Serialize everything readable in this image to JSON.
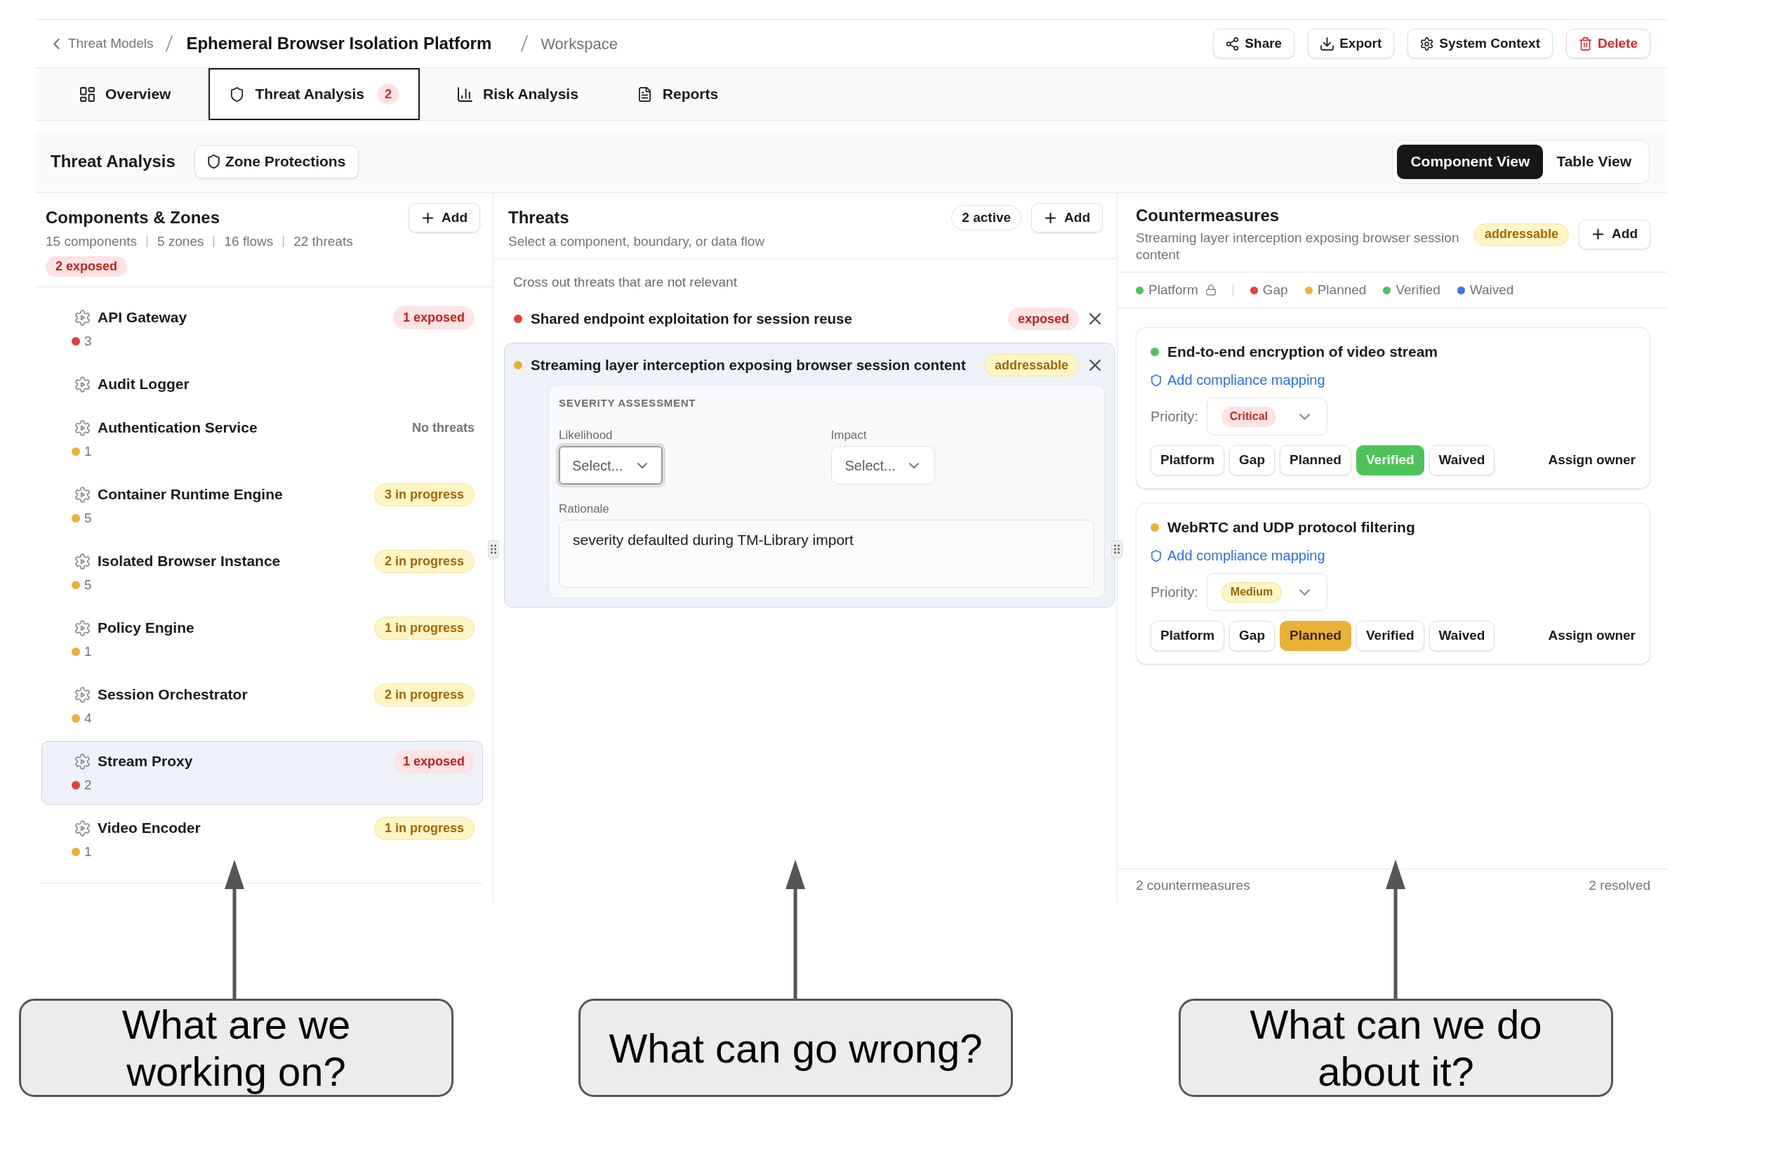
{
  "breadcrumb": {
    "back": "Threat Models",
    "title": "Ephemeral Browser Isolation Platform",
    "current": "Workspace"
  },
  "actions": [
    {
      "label": "Share",
      "kind": "default"
    },
    {
      "label": "Export",
      "kind": "default"
    },
    {
      "label": "System Context",
      "kind": "default"
    },
    {
      "label": "Delete",
      "kind": "danger"
    }
  ],
  "tabs": [
    {
      "label": "Overview",
      "selected": false
    },
    {
      "label": "Threat Analysis",
      "badge": "2",
      "selected": true
    },
    {
      "label": "Risk Analysis",
      "selected": false
    },
    {
      "label": "Reports",
      "selected": false
    }
  ],
  "toolbar": {
    "title": "Threat Analysis",
    "zone_button": "Zone Protections",
    "views": [
      {
        "label": "Component View",
        "selected": true
      },
      {
        "label": "Table View",
        "selected": false
      }
    ]
  },
  "components": {
    "title": "Components & Zones",
    "add": "Add",
    "stats": [
      "15 components",
      "5 zones",
      "16 flows",
      "22 threats"
    ],
    "badge": {
      "label": "2 exposed",
      "kind": "exposed"
    },
    "items": [
      {
        "name": "API Gateway",
        "status": {
          "label": "1 exposed",
          "kind": "exposed"
        },
        "count": "3",
        "color": "#e53e3e",
        "selected": false
      },
      {
        "name": "Audit Logger",
        "selected": false
      },
      {
        "name": "Authentication Service",
        "status": {
          "label": "No threats",
          "kind": "plain"
        },
        "count": "1",
        "color": "#e8b237",
        "selected": false
      },
      {
        "name": "Container Runtime Engine",
        "status": {
          "label": "3 in progress",
          "kind": "progress"
        },
        "count": "5",
        "color": "#e8b237",
        "selected": false
      },
      {
        "name": "Isolated Browser Instance",
        "status": {
          "label": "2 in progress",
          "kind": "progress"
        },
        "count": "5",
        "color": "#e8b237",
        "selected": false
      },
      {
        "name": "Policy Engine",
        "status": {
          "label": "1 in progress",
          "kind": "progress"
        },
        "count": "1",
        "color": "#e8b237",
        "selected": false
      },
      {
        "name": "Session Orchestrator",
        "status": {
          "label": "2 in progress",
          "kind": "progress"
        },
        "count": "4",
        "color": "#e8b237",
        "selected": false
      },
      {
        "name": "Stream Proxy",
        "status": {
          "label": "1 exposed",
          "kind": "exposed"
        },
        "count": "2",
        "color": "#e53e3e",
        "selected": true
      },
      {
        "name": "Video Encoder",
        "status": {
          "label": "1 in progress",
          "kind": "progress"
        },
        "count": "1",
        "color": "#e8b237",
        "selected": false
      }
    ]
  },
  "threats": {
    "title": "Threats",
    "subtitle": "Select a component, boundary, or data flow",
    "active": "2 active",
    "add": "Add",
    "hint": "Cross out threats that are not relevant",
    "items": [
      {
        "title": "Shared endpoint exploitation for session reuse",
        "color": "#e53e3e",
        "status": {
          "label": "exposed",
          "kind": "exposed"
        },
        "selected": false
      },
      {
        "title": "Streaming layer interception exposing browser session content",
        "color": "#e8b237",
        "status": {
          "label": "addressable",
          "kind": "addressable"
        },
        "selected": true,
        "assessment": {
          "heading": "SEVERITY ASSESSMENT",
          "fields": [
            {
              "label": "Likelihood",
              "placeholder": "Select...",
              "focused": true
            },
            {
              "label": "Impact",
              "placeholder": "Select...",
              "focused": false
            }
          ],
          "rationale": {
            "label": "Rationale",
            "value": "severity defaulted during TM-Library import"
          }
        }
      }
    ]
  },
  "countermeasures": {
    "title": "Countermeasures",
    "subtitle": "Streaming layer interception exposing browser session content",
    "status": {
      "label": "addressable",
      "kind": "addressable"
    },
    "add": "Add",
    "legend": [
      {
        "label": "Platform",
        "color": "#4fc35a",
        "locked": true
      },
      {
        "label": "Gap",
        "color": "#e53e3e",
        "locked": false
      },
      {
        "label": "Planned",
        "color": "#e8b237",
        "locked": false
      },
      {
        "label": "Verified",
        "color": "#4fc35a",
        "locked": false
      },
      {
        "label": "Waived",
        "color": "#3b74f0",
        "locked": false
      }
    ],
    "items": [
      {
        "title": "End-to-end encryption of video stream",
        "color": "#4fc35a",
        "compliance": "Add compliance mapping",
        "priority_label": "Priority:",
        "priority": {
          "label": "Critical",
          "kind": "critical"
        },
        "statuses": [
          {
            "label": "Platform",
            "selected": false
          },
          {
            "label": "Gap",
            "selected": false
          },
          {
            "label": "Planned",
            "selected": false
          },
          {
            "label": "Verified",
            "selected": true
          },
          {
            "label": "Waived",
            "selected": false
          }
        ],
        "assign": "Assign owner"
      },
      {
        "title": "WebRTC and UDP protocol filtering",
        "color": "#e8b237",
        "compliance": "Add compliance mapping",
        "priority_label": "Priority:",
        "priority": {
          "label": "Medium",
          "kind": "medium"
        },
        "statuses": [
          {
            "label": "Platform",
            "selected": false
          },
          {
            "label": "Gap",
            "selected": false
          },
          {
            "label": "Planned",
            "selected": true
          },
          {
            "label": "Verified",
            "selected": false
          },
          {
            "label": "Waived",
            "selected": false
          }
        ],
        "assign": "Assign owner"
      }
    ],
    "footer": {
      "count": "2 countermeasures",
      "resolved": "2 resolved"
    }
  },
  "callouts": [
    {
      "text": "What are we working on?"
    },
    {
      "text": "What can go wrong?"
    },
    {
      "text": "What can we do about it?"
    }
  ]
}
